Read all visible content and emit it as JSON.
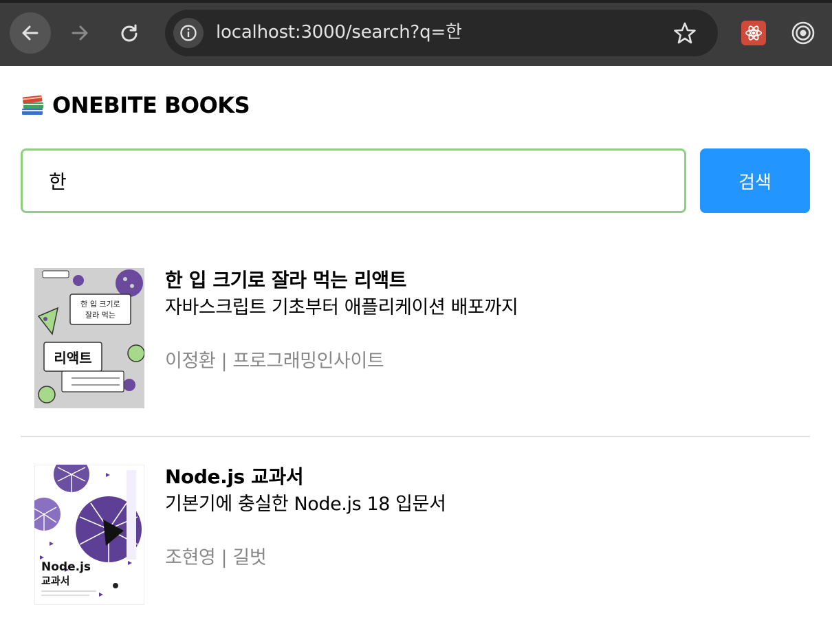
{
  "browser": {
    "url": "localhost:3000/search?q=한",
    "icons": {
      "back": "arrow-left-icon",
      "forward": "arrow-right-icon",
      "reload": "reload-icon",
      "site_info": "info-icon",
      "bookmark": "star-icon",
      "extension_1": "react-devtools-icon",
      "extension_2": "target-icon"
    }
  },
  "header": {
    "logo_icon": "books-icon",
    "title": "ONEBITE BOOKS"
  },
  "search": {
    "value": "한",
    "button_label": "검색"
  },
  "results": [
    {
      "title": "한 입 크기로 잘라 먹는 리액트",
      "subtitle": "자바스크립트 기초부터 애플리케이션 배포까지",
      "meta": "이정환 | 프로그래밍인사이트",
      "cover_text": "리액트"
    },
    {
      "title": "Node.js 교과서",
      "subtitle": "기본기에 충실한 Node.js 18 입문서",
      "meta": "조현영 | 길벗",
      "cover_text": "Node.js 교과서"
    }
  ],
  "colors": {
    "chrome_bg": "#3c3c3c",
    "omnibox_bg": "#282828",
    "input_border": "#8fcf82",
    "button_bg": "#2295fe",
    "meta_text": "#888888",
    "divider": "#e0e0e0"
  }
}
